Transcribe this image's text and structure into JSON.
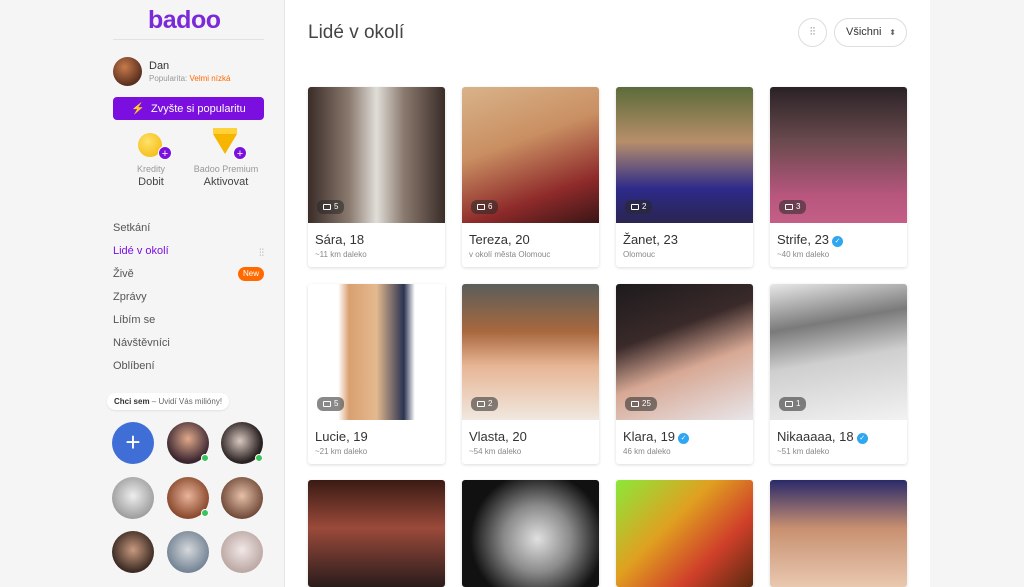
{
  "app": {
    "logo": "badoo"
  },
  "profile": {
    "name": "Dan",
    "popularity_label": "Popularita:",
    "popularity_value": "Velmi nízká"
  },
  "boost_button": {
    "label": "Zvyšte si popularitu",
    "icon": "bolt-icon"
  },
  "wallet": [
    {
      "label": "Kredity",
      "action": "Dobit",
      "icon": "coin-icon"
    },
    {
      "label": "Badoo Premium",
      "action": "Aktivovat",
      "icon": "diamond-icon"
    }
  ],
  "nav": [
    {
      "label": "Setkání"
    },
    {
      "label": "Lidé v okolí",
      "active": true
    },
    {
      "label": "Živě",
      "badge": "New"
    },
    {
      "label": "Zprávy"
    },
    {
      "label": "Líbím se"
    },
    {
      "label": "Návštěvníci"
    },
    {
      "label": "Oblíbení"
    }
  ],
  "spotlight": {
    "label_bold": "Chci sem",
    "label_rest": " – Uvidí Vás milióny!"
  },
  "header": {
    "title": "Lidé v okolí",
    "filter_icon": "sliders-icon",
    "select_value": "Všichni"
  },
  "people": [
    {
      "name": "Sára, 18",
      "distance": "~11 km daleko",
      "photos": "5",
      "verified": false
    },
    {
      "name": "Tereza, 20",
      "distance": "v okolí města Olomouc",
      "photos": "6",
      "verified": false
    },
    {
      "name": "Žanet, 23",
      "distance": "Olomouc",
      "photos": "2",
      "verified": false
    },
    {
      "name": "Strife, 23",
      "distance": "~40 km daleko",
      "photos": "3",
      "verified": true
    },
    {
      "name": "Lucie, 19",
      "distance": "~21 km daleko",
      "photos": "5",
      "verified": false
    },
    {
      "name": "Vlasta, 20",
      "distance": "~54 km daleko",
      "photos": "2",
      "verified": false
    },
    {
      "name": "Klara, 19",
      "distance": "46 km daleko",
      "photos": "25",
      "verified": true
    },
    {
      "name": "Nikaaaaa, 18",
      "distance": "~51 km daleko",
      "photos": "1",
      "verified": true
    }
  ],
  "colors": {
    "brand": "#7b0fe0",
    "accent_orange": "#ff6a00",
    "verified": "#2fa7f0",
    "online": "#3ac25b"
  }
}
